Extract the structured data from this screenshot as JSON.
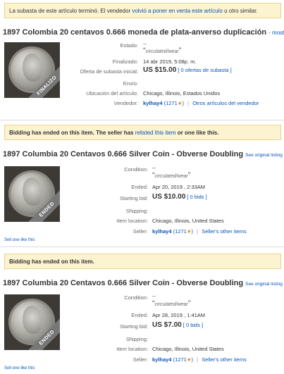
{
  "listings": [
    {
      "banner": {
        "text": "La subasta de este artículo terminó. El vendedor ",
        "link": "volvió a poner en venta este artículo",
        "tail": " u otro similar."
      },
      "title": "1897 Colombia 20 centavos 0.666 moneda de plata-anverso duplicación",
      "title_link": "- mostrar tít",
      "ribbon": "FINALIZO",
      "rows": {
        "condition_label": "Estado:",
        "condition_dash": "--",
        "condition_value": "circulated/wear",
        "ended_label": "Finalizado:",
        "ended_value": "14 abr 2019, 5:08p. m.",
        "bid_label": "Oferta de subasta inicial:",
        "bid_price": "US $15.00",
        "bid_count": "[ 0 ofertas de subasta ]",
        "shipping_label": "Envío:",
        "location_label": "Ubicación del artículo:",
        "location_value": "Chicago, Illinois, Estados Unidos",
        "seller_label": "Vendedor:",
        "seller_name": "kylhay4",
        "seller_score": "(1271",
        "seller_score_end": ")",
        "seller_other": "Otros artículos del vendedor"
      }
    },
    {
      "banner": {
        "text": "Bidding has ended on this item. The seller has ",
        "link": "relisted this item",
        "tail": " or one like this."
      },
      "title": "1897 Columbia 20 Centavos 0.666 Silver Coin - Obverse Doubling",
      "title_link": "See original listing",
      "ribbon": "ENDED",
      "rows": {
        "condition_label": "Condition:",
        "condition_dash": "--",
        "condition_value": "circulated/wear",
        "ended_label": "Ended:",
        "ended_value": "Apr 20, 2019 , 2:33AM",
        "bid_label": "Starting bid:",
        "bid_price": "US $10.00",
        "bid_count": "[ 0 bids ]",
        "shipping_label": "Shipping:",
        "location_label": "Item location:",
        "location_value": "Chicago, Illinois, United States",
        "seller_label": "Seller:",
        "seller_name": "kylhay4",
        "seller_score": "(1271",
        "seller_score_end": ")",
        "seller_other": "Seller's other items"
      },
      "sell_one": "Sell one like this"
    },
    {
      "banner": {
        "text": "Bidding has ended on this item.",
        "link": "",
        "tail": ""
      },
      "title": "1897 Columbia 20 Centavos 0.666 Silver Coin - Obverse Doubling",
      "title_link": "See original listing",
      "ribbon": "ENDED",
      "rows": {
        "condition_label": "Condition:",
        "condition_dash": "--",
        "condition_value": "circulated/wear",
        "ended_label": "Ended:",
        "ended_value": "Apr 28, 2019 , 1:41AM",
        "bid_label": "Starting bid:",
        "bid_price": "US $7.00",
        "bid_count": "[ 0 bids ]",
        "shipping_label": "Shipping:",
        "location_label": "Item location:",
        "location_value": "Chicago, Illinois, United States",
        "seller_label": "Seller:",
        "seller_name": "kylhay4",
        "seller_score": "(1271",
        "seller_score_end": ")",
        "seller_other": "Seller's other items"
      },
      "sell_one": "Sell one like this"
    }
  ],
  "colors": {
    "banner_bg": "#fcf3d0",
    "link": "#0654ba",
    "star": "#e9891f"
  }
}
